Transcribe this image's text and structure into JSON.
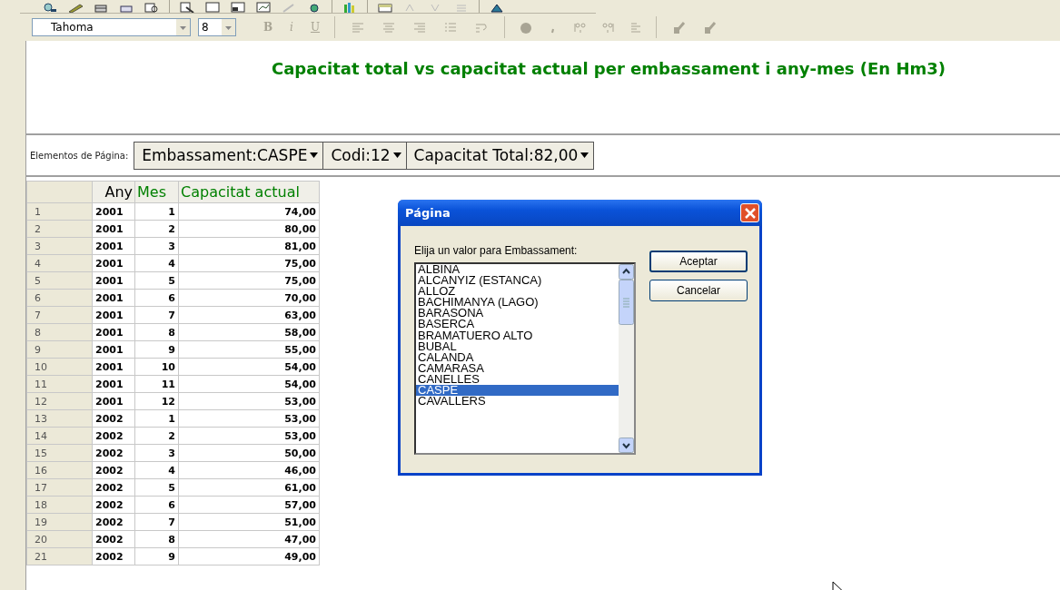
{
  "toolbar_format": {
    "font": "Tahoma",
    "size": "8",
    "style_buttons": [
      {
        "label": "B",
        "disabled": true
      },
      {
        "label": "i",
        "disabled": true
      },
      {
        "label": "U",
        "disabled": true
      }
    ]
  },
  "report_title": "Capacitat total vs capacitat actual per embassament i any-mes (En Hm3)",
  "page_fields": {
    "label": "Elementos de Página:",
    "fields": [
      "Embassament:CASPE",
      "Codi:12",
      "Capacitat Total:82,00"
    ]
  },
  "table": {
    "columns": [
      {
        "label": "Any",
        "color": "#000000"
      },
      {
        "label": "Mes",
        "color": "#008000"
      },
      {
        "label": "Capacitat actual",
        "color": "#008000"
      }
    ],
    "rows": [
      {
        "number": "1",
        "any": "2001",
        "mes": "1",
        "capacitat": "74,00"
      },
      {
        "number": "2",
        "any": "2001",
        "mes": "2",
        "capacitat": "80,00"
      },
      {
        "number": "3",
        "any": "2001",
        "mes": "3",
        "capacitat": "81,00"
      },
      {
        "number": "4",
        "any": "2001",
        "mes": "4",
        "capacitat": "75,00"
      },
      {
        "number": "5",
        "any": "2001",
        "mes": "5",
        "capacitat": "75,00"
      },
      {
        "number": "6",
        "any": "2001",
        "mes": "6",
        "capacitat": "70,00"
      },
      {
        "number": "7",
        "any": "2001",
        "mes": "7",
        "capacitat": "63,00"
      },
      {
        "number": "8",
        "any": "2001",
        "mes": "8",
        "capacitat": "58,00"
      },
      {
        "number": "9",
        "any": "2001",
        "mes": "9",
        "capacitat": "55,00"
      },
      {
        "number": "10",
        "any": "2001",
        "mes": "10",
        "capacitat": "54,00"
      },
      {
        "number": "11",
        "any": "2001",
        "mes": "11",
        "capacitat": "54,00"
      },
      {
        "number": "12",
        "any": "2001",
        "mes": "12",
        "capacitat": "53,00"
      },
      {
        "number": "13",
        "any": "2002",
        "mes": "1",
        "capacitat": "53,00"
      },
      {
        "number": "14",
        "any": "2002",
        "mes": "2",
        "capacitat": "53,00"
      },
      {
        "number": "15",
        "any": "2002",
        "mes": "3",
        "capacitat": "50,00"
      },
      {
        "number": "16",
        "any": "2002",
        "mes": "4",
        "capacitat": "46,00"
      },
      {
        "number": "17",
        "any": "2002",
        "mes": "5",
        "capacitat": "61,00"
      },
      {
        "number": "18",
        "any": "2002",
        "mes": "6",
        "capacitat": "57,00"
      },
      {
        "number": "19",
        "any": "2002",
        "mes": "7",
        "capacitat": "51,00"
      },
      {
        "number": "20",
        "any": "2002",
        "mes": "8",
        "capacitat": "47,00"
      },
      {
        "number": "21",
        "any": "2002",
        "mes": "9",
        "capacitat": "49,00"
      }
    ]
  },
  "dialog": {
    "title": "Página",
    "prompt": "Elija un valor para Embassament:",
    "items": [
      {
        "label": "ALBINA",
        "selected": false
      },
      {
        "label": "ALCANYIZ (ESTANCA)",
        "selected": false
      },
      {
        "label": "ALLOZ",
        "selected": false
      },
      {
        "label": "BACHIMANYA (LAGO)",
        "selected": false
      },
      {
        "label": "BARASONA",
        "selected": false
      },
      {
        "label": "BASERCA",
        "selected": false
      },
      {
        "label": "BRAMATUERO ALTO",
        "selected": false
      },
      {
        "label": "BUBAL",
        "selected": false
      },
      {
        "label": "CALANDA",
        "selected": false
      },
      {
        "label": "CAMARASA",
        "selected": false
      },
      {
        "label": "CANELLES",
        "selected": false
      },
      {
        "label": "CASPE",
        "selected": true
      },
      {
        "label": "CAVALLERS",
        "selected": false
      }
    ],
    "buttons": [
      "Aceptar",
      "Cancelar"
    ]
  }
}
